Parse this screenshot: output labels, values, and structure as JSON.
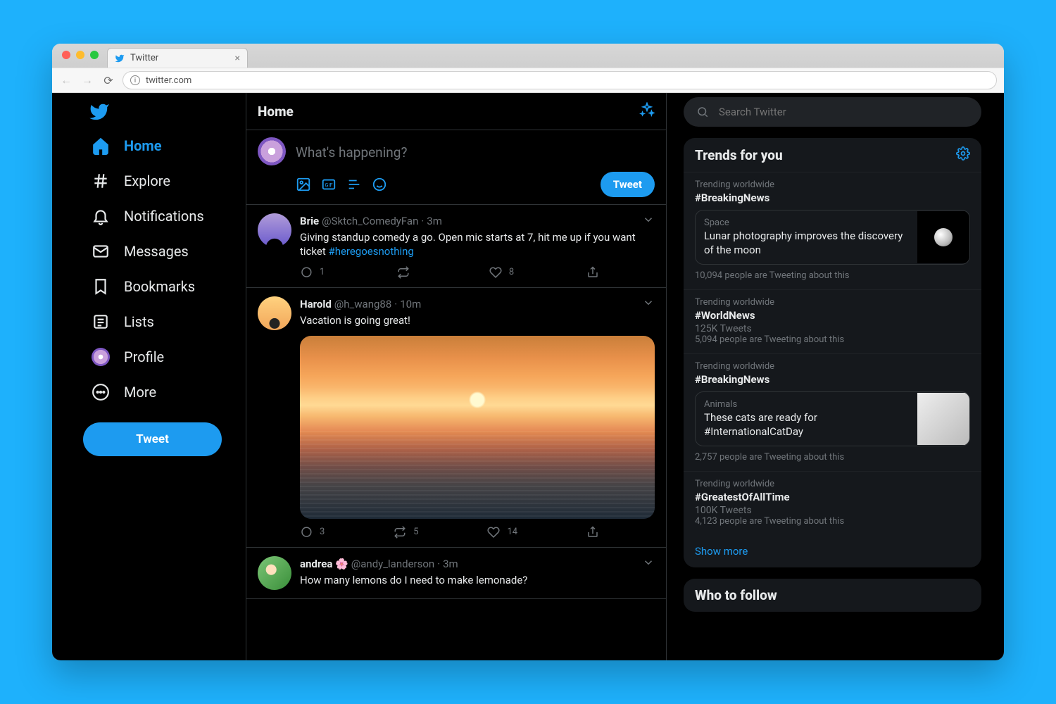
{
  "browser": {
    "tab_title": "Twitter",
    "url": "twitter.com"
  },
  "sidebar": {
    "items": [
      {
        "label": "Home",
        "active": true
      },
      {
        "label": "Explore"
      },
      {
        "label": "Notifications"
      },
      {
        "label": "Messages"
      },
      {
        "label": "Bookmarks"
      },
      {
        "label": "Lists"
      },
      {
        "label": "Profile"
      },
      {
        "label": "More"
      }
    ],
    "tweet_label": "Tweet"
  },
  "header": {
    "title": "Home"
  },
  "composer": {
    "placeholder": "What's happening?",
    "tweet_label": "Tweet"
  },
  "feed": [
    {
      "name": "Brie",
      "handle": "@Sktch_ComedyFan",
      "time": "3m",
      "text_before": "Giving standup comedy a go. Open mic starts at 7, hit me up if you want ticket ",
      "hashtag": "#heregoesnothing",
      "reply_count": "1",
      "retweet_count": "",
      "like_count": "8"
    },
    {
      "name": "Harold",
      "handle": "@h_wang88",
      "time": "10m",
      "text_before": "Vacation is going great!",
      "hashtag": "",
      "reply_count": "3",
      "retweet_count": "5",
      "like_count": "14"
    },
    {
      "name": "andrea 🌸",
      "handle": "@andy_landerson",
      "time": "3m",
      "text_before": "How many lemons do I need to make lemonade?",
      "hashtag": "",
      "reply_count": "",
      "retweet_count": "",
      "like_count": ""
    }
  ],
  "search": {
    "placeholder": "Search Twitter"
  },
  "trends": {
    "title": "Trends for you",
    "items": [
      {
        "meta": "Trending worldwide",
        "tag": "#BreakingNews",
        "card": {
          "category": "Space",
          "title": "Lunar photography improves the discovery of the moon",
          "thumb": "moon"
        },
        "foot": "10,094 people are Tweeting about this"
      },
      {
        "meta": "Trending worldwide",
        "tag": "#WorldNews",
        "sub": "125K Tweets",
        "foot": "5,094 people are Tweeting about this"
      },
      {
        "meta": "Trending worldwide",
        "tag": "#BreakingNews",
        "card": {
          "category": "Animals",
          "title": "These cats are ready for #InternationalCatDay",
          "thumb": "cat"
        },
        "foot": "2,757 people are Tweeting about this"
      },
      {
        "meta": "Trending worldwide",
        "tag": "#GreatestOfAllTime",
        "sub": "100K Tweets",
        "foot": "4,123 people are Tweeting about this"
      }
    ],
    "show_more": "Show more"
  },
  "who_to_follow": {
    "title": "Who to follow"
  }
}
